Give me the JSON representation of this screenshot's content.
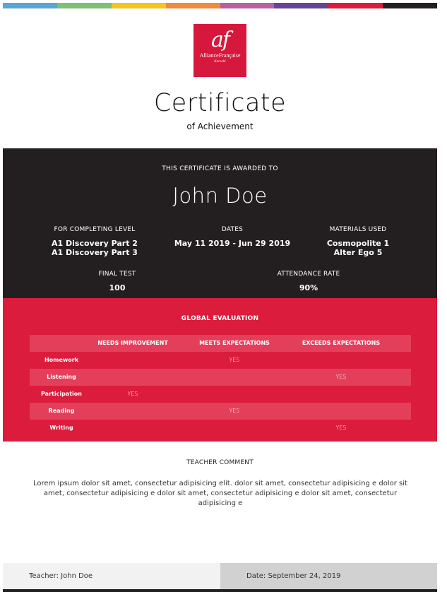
{
  "colors": {
    "stripes": [
      "#5ba5d2",
      "#7dbf73",
      "#f4c41f",
      "#ef8b3c",
      "#b760a0",
      "#644594",
      "#dc1c3c",
      "#231f20"
    ],
    "brand_red": "#dc1c3c",
    "dark_band": "#231f20"
  },
  "logo": {
    "mark": "af",
    "name": "AllianceFrançaise",
    "city": "Karachi"
  },
  "certificate": {
    "title": "Certificate",
    "subtitle": "of Achievement"
  },
  "award": {
    "label": "THIS CERTIFICATE IS AWARDED TO",
    "recipient": "John Doe"
  },
  "details": {
    "level": {
      "label": "FOR COMPLETING LEVEL",
      "values": [
        "A1 Discovery Part 2",
        "A1 Discovery Part 3"
      ]
    },
    "dates": {
      "label": "DATES",
      "values": [
        "May 11 2019 - Jun 29 2019"
      ]
    },
    "materials": {
      "label": "MATERIALS USED",
      "values": [
        "Cosmopolite 1",
        "Alter Ego 5"
      ]
    },
    "final_test": {
      "label": "FINAL TEST",
      "value": "100"
    },
    "attendance": {
      "label": "ATTENDANCE RATE",
      "value": "90%"
    }
  },
  "evaluation": {
    "title": "GLOBAL EVALUATION",
    "columns": [
      "NEEDS IMPROVEMENT",
      "MEETS EXPECTATIONS",
      "EXCEEDS EXPECTATIONS"
    ],
    "rows": [
      {
        "label": "Homework",
        "rating": "MEETS EXPECTATIONS",
        "mark": "YES"
      },
      {
        "label": "Listening",
        "rating": "EXCEEDS EXPECTATIONS",
        "mark": "YES"
      },
      {
        "label": "Participation",
        "rating": "NEEDS IMPROVEMENT",
        "mark": "YES"
      },
      {
        "label": "Reading",
        "rating": "MEETS EXPECTATIONS",
        "mark": "YES"
      },
      {
        "label": "Writing",
        "rating": "EXCEEDS EXPECTATIONS",
        "mark": "YES"
      }
    ]
  },
  "comment": {
    "label": "TEACHER COMMENT",
    "text": "Lorem ipsum dolor sit amet, consectetur adipisicing elit. dolor sit amet, consectetur adipisicing e dolor sit amet, consectetur adipisicing e dolor sit amet, consectetur adipisicing e dolor sit amet, consectetur adipisicing e"
  },
  "footer": {
    "teacher": "Teacher: John Doe",
    "date": "Date: September 24, 2019"
  }
}
